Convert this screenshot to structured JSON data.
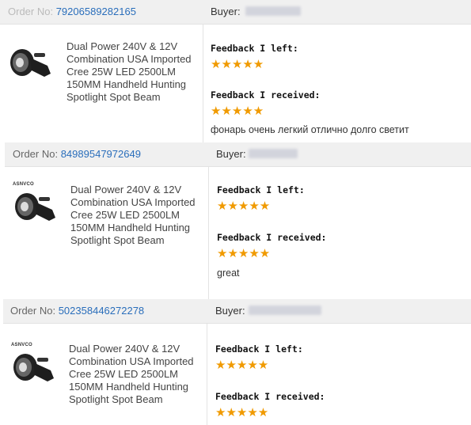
{
  "orders": [
    {
      "order_label": "Order No:",
      "order_number": "79206589282165",
      "buyer_label": "Buyer:",
      "brand": "",
      "product_title": "Dual Power 240V & 12V Combination USA Imported Cree 25W LED 2500LM 150MM Handheld Hunting Spotlight Spot Beam",
      "feedback_left_label": "Feedback I left:",
      "feedback_left_stars": 5,
      "feedback_received_label": "Feedback I received:",
      "feedback_received_stars": 5,
      "comment": "фонарь очень легкий отлично долго светит"
    },
    {
      "order_label": "Order No:",
      "order_number": "84989547972649",
      "buyer_label": "Buyer:",
      "brand": "ASNVCO",
      "product_title": "Dual Power 240V & 12V Combination USA Imported Cree 25W LED 2500LM 150MM Handheld Hunting Spotlight Spot Beam",
      "feedback_left_label": "Feedback I left:",
      "feedback_left_stars": 5,
      "feedback_received_label": "Feedback I received:",
      "feedback_received_stars": 5,
      "comment": "great"
    },
    {
      "order_label": "Order No:",
      "order_number": "502358446272278",
      "buyer_label": "Buyer:",
      "brand": "ASNVCO",
      "product_title": "Dual Power 240V & 12V Combination USA Imported Cree 25W LED 2500LM 150MM Handheld Hunting Spotlight Spot Beam",
      "feedback_left_label": "Feedback I left:",
      "feedback_left_stars": 5,
      "feedback_received_label": "Feedback I received:",
      "feedback_received_stars": 5,
      "comment": ""
    }
  ],
  "star_glyph": "★★★★★",
  "colors": {
    "link": "#2a6ebb",
    "star": "#f09a00",
    "header_bg": "#f0f0f0"
  }
}
